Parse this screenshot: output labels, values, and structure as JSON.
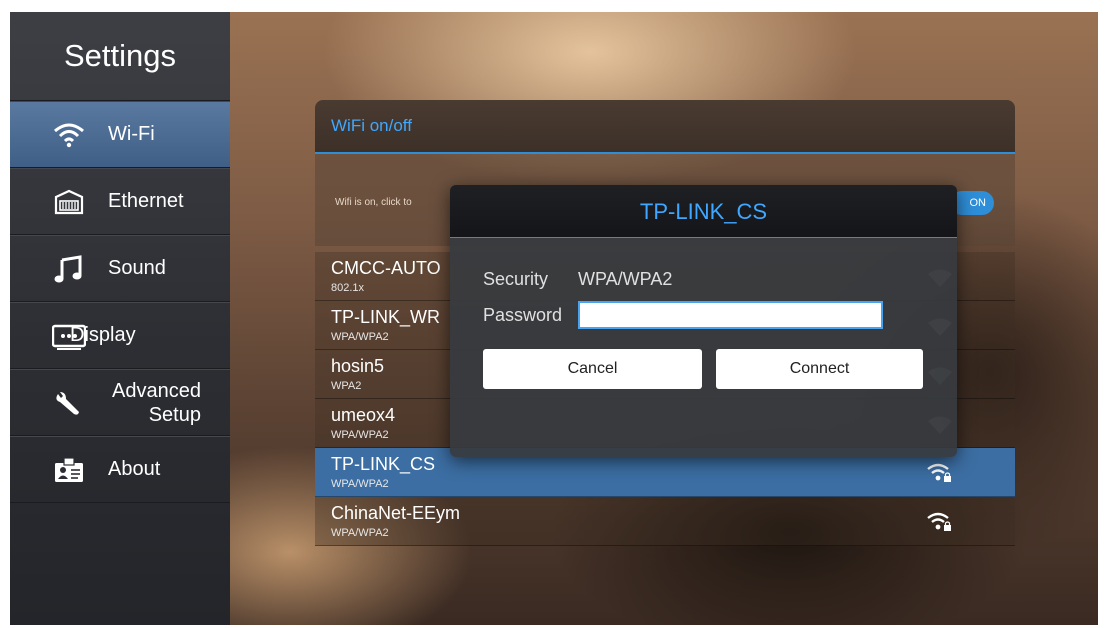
{
  "sidebar": {
    "title": "Settings",
    "items": [
      {
        "label": "Wi-Fi",
        "icon": "wifi-icon",
        "active": true
      },
      {
        "label": "Ethernet",
        "icon": "ethernet-icon"
      },
      {
        "label": "Sound",
        "icon": "music-note-icon"
      },
      {
        "label": "Display",
        "icon": "display-icon"
      },
      {
        "label_line1": "Advanced",
        "label_line2": "Setup",
        "icon": "wrench-icon"
      },
      {
        "label": "About",
        "icon": "id-card-icon"
      }
    ]
  },
  "wifi_panel": {
    "title": "WiFi on/off",
    "hint": "Wifi is on, click to",
    "toggle_label": "ON"
  },
  "networks": [
    {
      "ssid": "CMCC-AUTO",
      "security": "802.1x"
    },
    {
      "ssid": "TP-LINK_WR",
      "security": "WPA/WPA2"
    },
    {
      "ssid": "hosin5",
      "security": "WPA2"
    },
    {
      "ssid": "umeox4",
      "security": "WPA/WPA2"
    },
    {
      "ssid": "TP-LINK_CS",
      "security": "WPA/WPA2",
      "selected": true
    },
    {
      "ssid": "ChinaNet-EEym",
      "security": "WPA/WPA2"
    }
  ],
  "dialog": {
    "title": "TP-LINK_CS",
    "security_label": "Security",
    "security_value": "WPA/WPA2",
    "password_label": "Password",
    "password_value": "",
    "cancel_label": "Cancel",
    "connect_label": "Connect"
  },
  "colors": {
    "accent": "#3fa7ff",
    "selected_row": "#3c6ea3",
    "sidebar_active": "#4d6d95"
  }
}
